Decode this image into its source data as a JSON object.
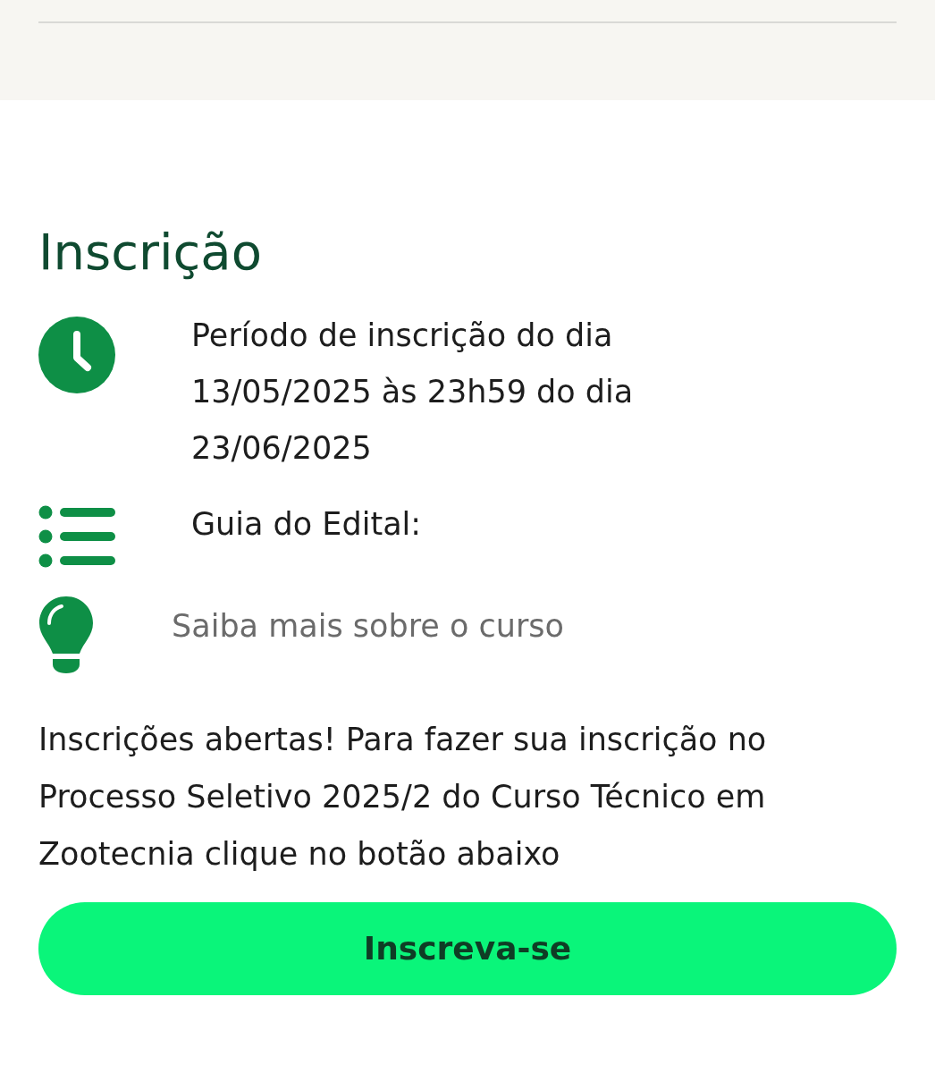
{
  "section": {
    "title": "Inscrição"
  },
  "info_items": [
    {
      "kind": "clock",
      "text": "Período de inscrição do dia 13/05/2025 às 23h59 do dia 23/06/2025"
    },
    {
      "kind": "list",
      "text": "Guia do Edital:"
    },
    {
      "kind": "bulb",
      "text": "Saiba mais sobre o curso"
    }
  ],
  "description": "Inscrições abertas! Para fazer sua inscrição no Processo Seletivo 2025/2 do Curso Técnico em Zootecnia clique no botão abaixo",
  "button": {
    "label": "Inscreva-se"
  }
}
